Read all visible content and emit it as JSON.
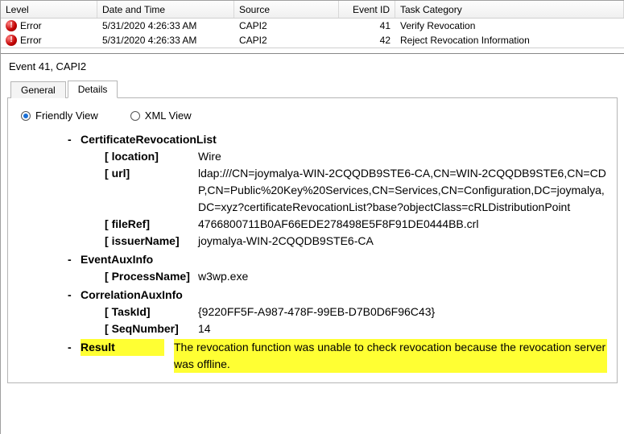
{
  "grid": {
    "columns": {
      "level": "Level",
      "date": "Date and Time",
      "source": "Source",
      "eventid": "Event ID",
      "task": "Task Category"
    },
    "rows": [
      {
        "level": "Error",
        "date": "5/31/2020 4:26:33 AM",
        "source": "CAPI2",
        "eventid": "41",
        "task": "Verify Revocation"
      },
      {
        "level": "Error",
        "date": "5/31/2020 4:26:33 AM",
        "source": "CAPI2",
        "eventid": "42",
        "task": "Reject Revocation Information"
      }
    ]
  },
  "detail": {
    "title": "Event 41, CAPI2",
    "tabs": {
      "general": "General",
      "details": "Details"
    },
    "views": {
      "friendly": "Friendly View",
      "xml": "XML View"
    },
    "nodes": {
      "crl": {
        "name": "CertificateRevocationList",
        "location": {
          "k": "location",
          "v": "Wire"
        },
        "url": {
          "k": "url",
          "v": "ldap:///CN=joymalya-WIN-2CQQDB9STE6-CA,CN=WIN-2CQQDB9STE6,CN=CDP,CN=Public%20Key%20Services,CN=Services,CN=Configuration,DC=joymalya,DC=xyz?certificateRevocationList?base?objectClass=cRLDistributionPoint"
        },
        "fileRef": {
          "k": "fileRef",
          "v": "4766800711B0AF66EDE278498E5F8F91DE0444BB.crl"
        },
        "issuerName": {
          "k": "issuerName",
          "v": "joymalya-WIN-2CQQDB9STE6-CA"
        }
      },
      "aux": {
        "name": "EventAuxInfo",
        "processName": {
          "k": "ProcessName",
          "v": "w3wp.exe"
        }
      },
      "corr": {
        "name": "CorrelationAuxInfo",
        "taskId": {
          "k": "TaskId",
          "v": "{9220FF5F-A987-478F-99EB-D7B0D6F96C43}"
        },
        "seqNumber": {
          "k": "SeqNumber",
          "v": "14"
        }
      },
      "result": {
        "name": "Result",
        "value": "The revocation function was unable to check revocation because the revocation server was offline."
      }
    }
  }
}
